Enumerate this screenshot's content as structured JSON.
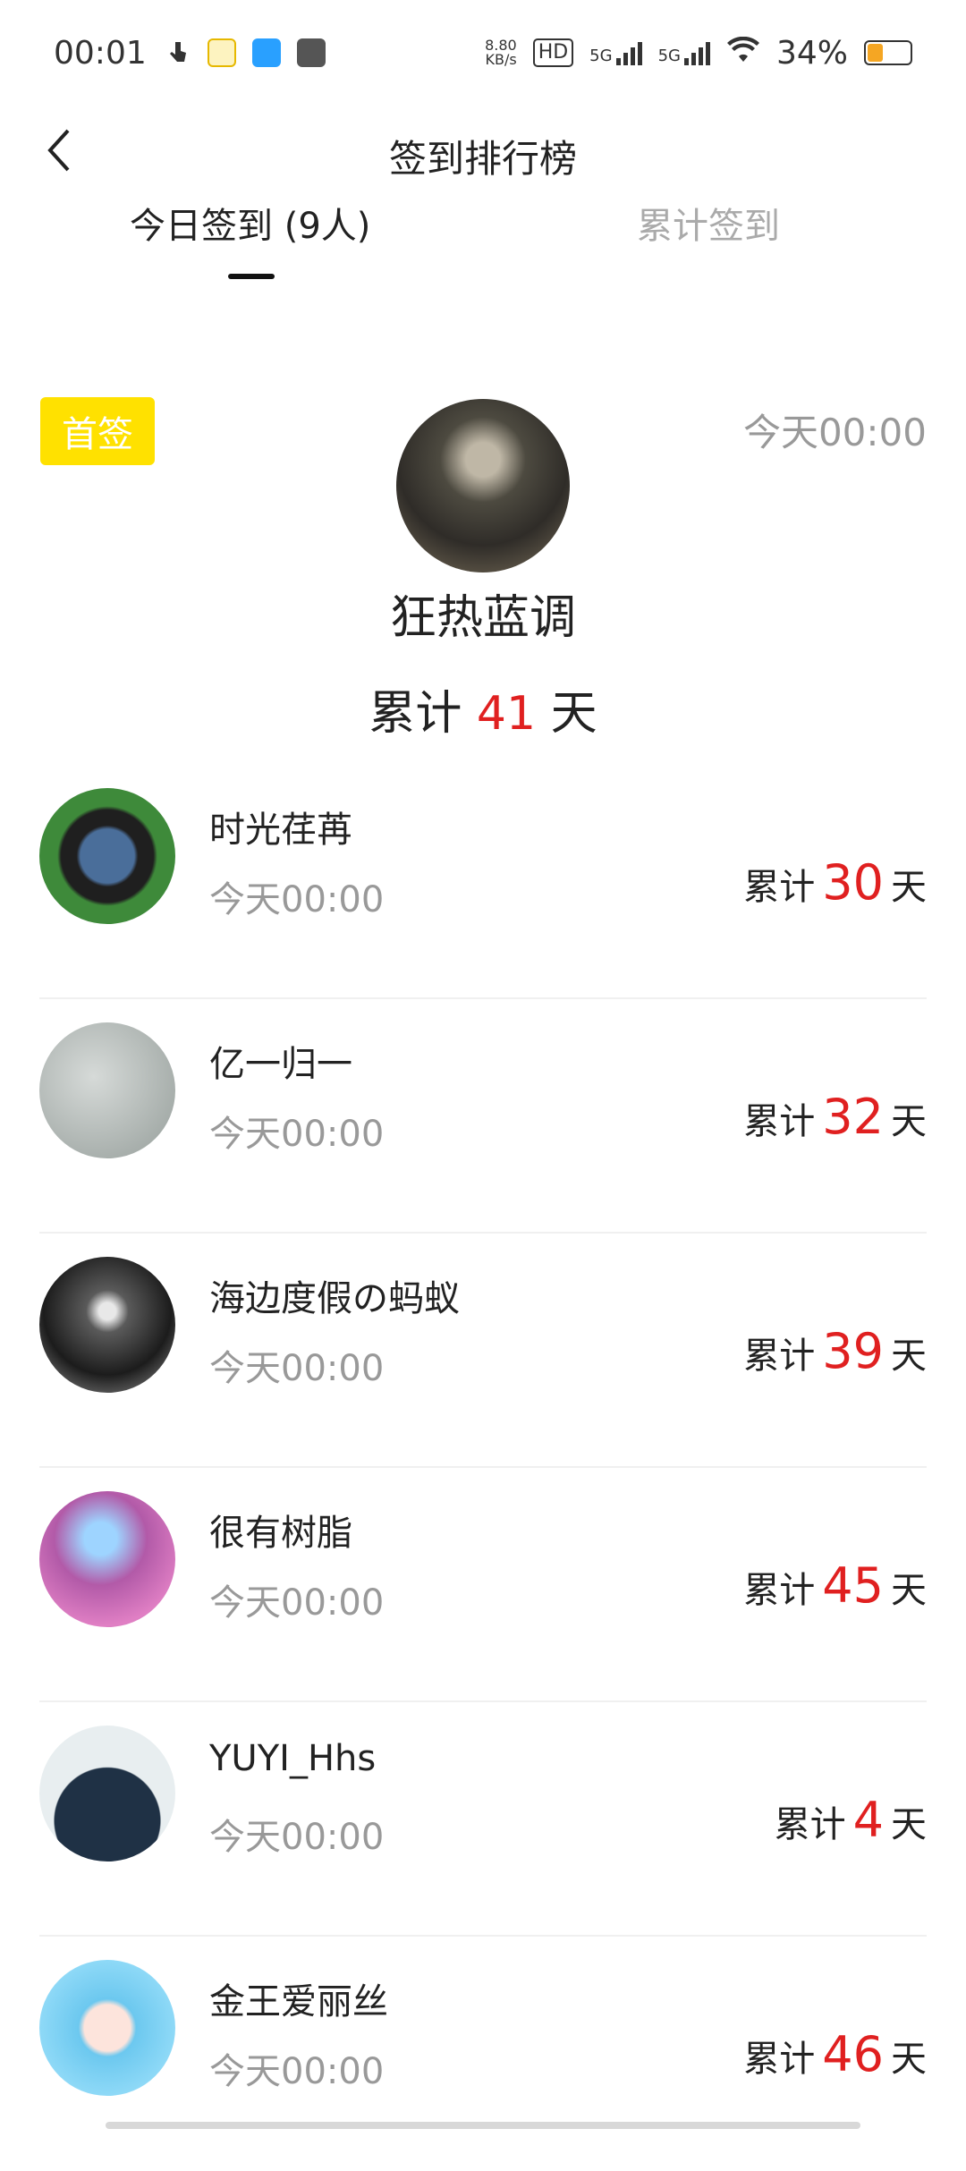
{
  "status_bar": {
    "time": "00:01",
    "net_speed": "8.80",
    "net_unit": "KB/s",
    "hd": "HD",
    "signal1": "5G",
    "signal2": "5G",
    "battery": "34%"
  },
  "header": {
    "title": "签到排行榜"
  },
  "tabs": [
    {
      "label": "今日签到 (9人)",
      "active": true
    },
    {
      "label": "累计签到",
      "active": false
    }
  ],
  "top_user": {
    "badge": "首签",
    "time": "今天00:00",
    "name": "狂热蓝调",
    "count_prefix": "累计",
    "count": "41",
    "count_suffix": "天"
  },
  "rows": [
    {
      "name": "时光荏苒",
      "time": "今天00:00",
      "prefix": "累计",
      "count": "30",
      "suffix": "天"
    },
    {
      "name": "亿一归一",
      "time": "今天00:00",
      "prefix": "累计",
      "count": "32",
      "suffix": "天"
    },
    {
      "name": "海边度假の蚂蚁",
      "time": "今天00:00",
      "prefix": "累计",
      "count": "39",
      "suffix": "天"
    },
    {
      "name": "很有树脂",
      "time": "今天00:00",
      "prefix": "累计",
      "count": "45",
      "suffix": "天"
    },
    {
      "name": "YUYI_Hhs",
      "time": "今天00:00",
      "prefix": "累计",
      "count": "4",
      "suffix": "天"
    },
    {
      "name": "金王爱丽丝",
      "time": "今天00:00",
      "prefix": "累计",
      "count": "46",
      "suffix": "天"
    }
  ],
  "colors": {
    "accent_red": "#e02020",
    "badge_yellow": "#ffe100",
    "muted_text": "#999999"
  }
}
